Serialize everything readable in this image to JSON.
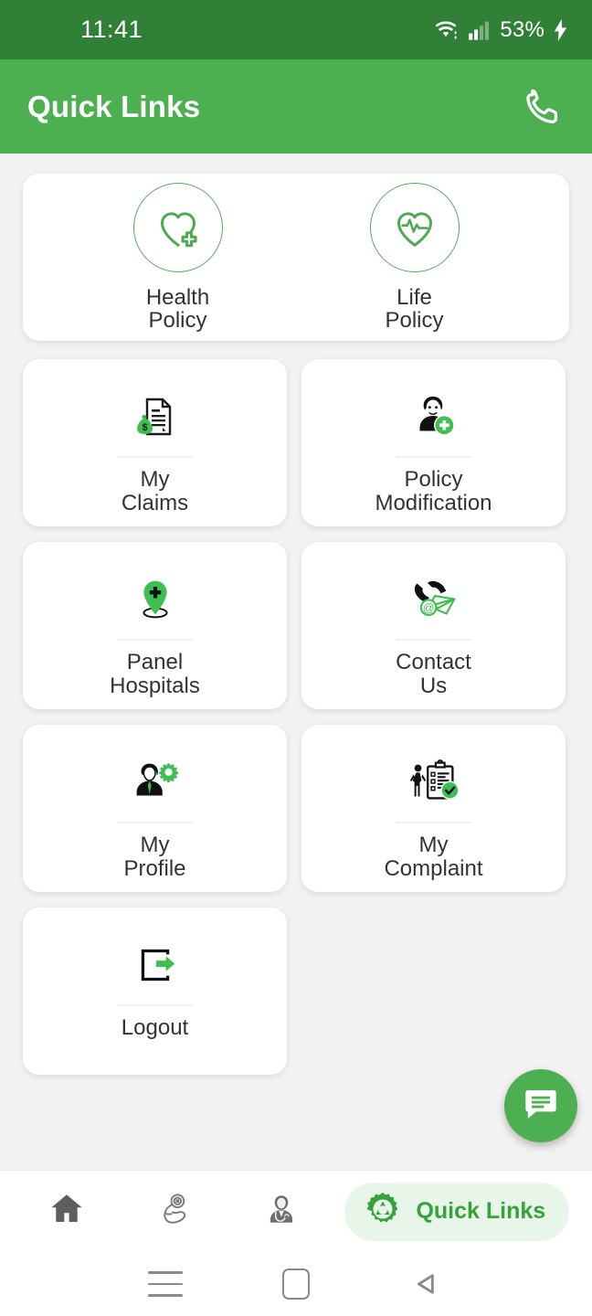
{
  "status_bar": {
    "time": "11:41",
    "battery": "53%",
    "wifi_icon": "wifi-icon",
    "signal_icon": "cellular-signal-icon",
    "charging_icon": "charging-bolt-icon"
  },
  "app_bar": {
    "title": "Quick Links",
    "call_icon": "phone-call-icon"
  },
  "policy_card": {
    "items": [
      {
        "label_line1": "Health",
        "label_line2": "Policy",
        "icon": "heart-plus-icon"
      },
      {
        "label_line1": "Life",
        "label_line2": "Policy",
        "icon": "heart-pulse-icon"
      }
    ]
  },
  "grid": {
    "tiles": [
      {
        "label_line1": "My",
        "label_line2": "Claims",
        "icon": "document-money-icon"
      },
      {
        "label_line1": "Policy",
        "label_line2": "Modification",
        "icon": "person-plus-icon"
      },
      {
        "label_line1": "Panel",
        "label_line2": "Hospitals",
        "icon": "map-pin-plus-icon"
      },
      {
        "label_line1": "Contact",
        "label_line2": "Us",
        "icon": "phone-envelope-icon"
      },
      {
        "label_line1": "My",
        "label_line2": "Profile",
        "icon": "person-gear-icon"
      },
      {
        "label_line1": "My",
        "label_line2": "Complaint",
        "icon": "clipboard-check-icon"
      },
      {
        "label_line1": "Logout",
        "label_line2": "",
        "icon": "logout-arrow-icon"
      }
    ]
  },
  "fab": {
    "icon": "chat-bubble-icon"
  },
  "bottom_nav": {
    "items": [
      {
        "label": "",
        "icon": "home-icon",
        "active": false
      },
      {
        "label": "",
        "icon": "fitness-arm-icon",
        "active": false
      },
      {
        "label": "",
        "icon": "doctor-icon",
        "active": false
      },
      {
        "label": "Quick Links",
        "icon": "gear-icon",
        "active": true
      }
    ]
  },
  "system_nav": {
    "recents_icon": "recents-menu-icon",
    "home_icon": "home-square-icon",
    "back_icon": "back-triangle-icon"
  },
  "colors": {
    "status_bar": "#318038",
    "app_bar": "#4caf50",
    "accent_green": "#4caf50",
    "icon_green": "#3fbf52",
    "active_pill_bg": "#e8f5e9",
    "active_pill_text": "#35a23c",
    "page_bg": "#f2f2f2",
    "card_bg": "#ffffff",
    "label_text": "#333333"
  }
}
